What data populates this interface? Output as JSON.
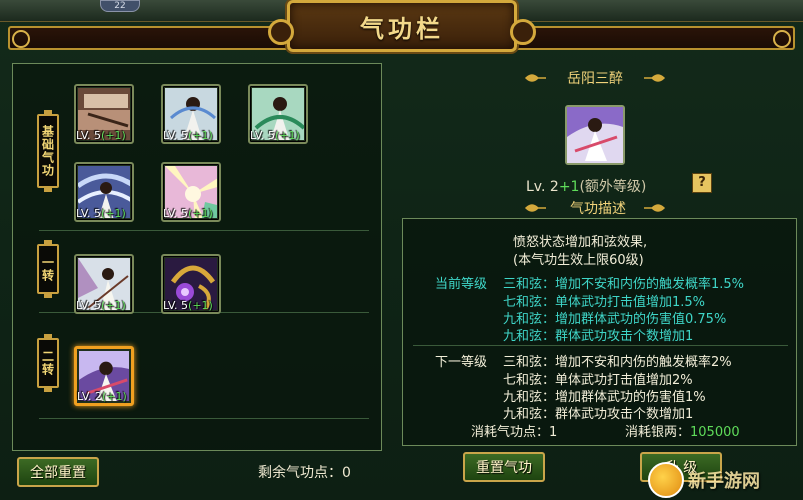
{
  "top": {
    "badge": "22"
  },
  "window": {
    "title": "气功栏"
  },
  "tiers": [
    {
      "label": "基础气功"
    },
    {
      "label": "一转"
    },
    {
      "label": "二转"
    }
  ],
  "skills": [
    {
      "level": "LV. 5",
      "bonus": "(+1)",
      "art": "hand"
    },
    {
      "level": "LV. 5",
      "bonus": "(+1)",
      "art": "warrior"
    },
    {
      "level": "LV. 5",
      "bonus": "(+1)",
      "art": "warrior-green"
    },
    {
      "level": "LV. 5",
      "bonus": "(+1)",
      "art": "wind"
    },
    {
      "level": "LV. 5",
      "bonus": "(+1)",
      "art": "light"
    },
    {
      "level": "LV. 5",
      "bonus": "(+1)",
      "art": "dancer"
    },
    {
      "level": "LV. 5",
      "bonus": "(+1)",
      "art": "orb"
    },
    {
      "level": "LV. 2",
      "bonus": "(+1)",
      "art": "purple"
    }
  ],
  "remaining_label": "剩余气功点：0",
  "buttons": {
    "reset_all": "全部重置",
    "reset_skill": "重置气功",
    "upgrade": "升 级"
  },
  "detail": {
    "name": "岳阳三醉",
    "level": "Lv. 2",
    "bonus": "+1",
    "extra": "(额外等级)",
    "help": "?",
    "desc_title": "气功描述",
    "desc_lines": [
      "愤怒状态增加和弦效果,",
      "(本气功生效上限60级)"
    ],
    "current_label": "当前等级",
    "current": [
      "三和弦：增加不安和内伤的触发概率1.5%",
      "七和弦：单体武功打击值增加1.5%",
      "九和弦：增加群体武功的伤害值0.75%",
      "九和弦：群体武功攻击个数增加1"
    ],
    "next_label": "下一等级",
    "next": [
      "三和弦：增加不安和内伤的触发概率2%",
      "七和弦：单体武功打击值增加2%",
      "九和弦：增加群体武功的伤害值1%",
      "九和弦：群体武功攻击个数增加1"
    ],
    "cost_points_label": "消耗气功点：",
    "cost_points": "1",
    "cost_silver_label": "消耗银两：",
    "cost_silver": "105000"
  },
  "watermark": "新手游网",
  "colors": {
    "accent_gold": "#d4a93c",
    "bonus_green": "#5fdc5a",
    "current_cyan": "#3fd6c8"
  }
}
